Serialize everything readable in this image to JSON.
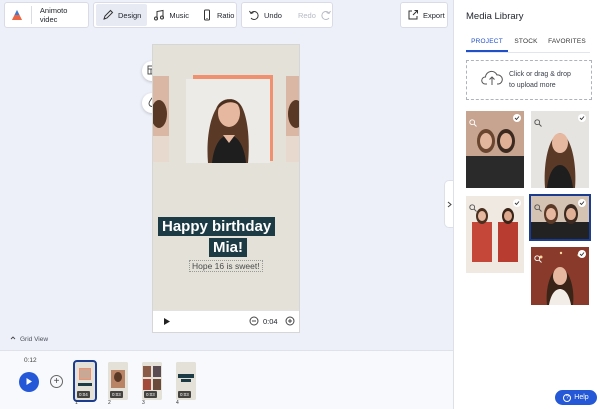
{
  "toolbar": {
    "project_name": "Animoto videc",
    "design_label": "Design",
    "music_label": "Music",
    "ratio_label": "Ratio",
    "undo_label": "Undo",
    "redo_label": "Redo",
    "export_label": "Export",
    "icons": [
      "animoto-logo-icon",
      "pencil-icon",
      "music-note-icon",
      "phone-ratio-icon",
      "undo-icon",
      "redo-icon",
      "export-icon"
    ]
  },
  "preview": {
    "title_line1": "Happy birthday",
    "title_line2": "Mia!",
    "subtitle": "Hope 16 is sweet!",
    "time": "0:04",
    "background_color": "#e3e1d8",
    "title_bg_color": "#1d3b44"
  },
  "grid_view_label": "Grid View",
  "timeline": {
    "current_time": "0:12",
    "clips": [
      {
        "number": "1",
        "duration": "0:04",
        "selected": true
      },
      {
        "number": "2",
        "duration": "0:03",
        "selected": false
      },
      {
        "number": "3",
        "duration": "0:03",
        "selected": false
      },
      {
        "number": "4",
        "duration": "0:03",
        "selected": false
      }
    ]
  },
  "panel": {
    "title": "Media Library",
    "tabs": [
      "PROJECT",
      "STOCK",
      "FAVORITES"
    ],
    "active_tab": "PROJECT",
    "upload_line1": "Click or drag & drop",
    "upload_line2": "to upload more"
  },
  "help_label": "Help",
  "colors": {
    "accent": "#2458d6",
    "selected_border": "#1b3c8f"
  }
}
